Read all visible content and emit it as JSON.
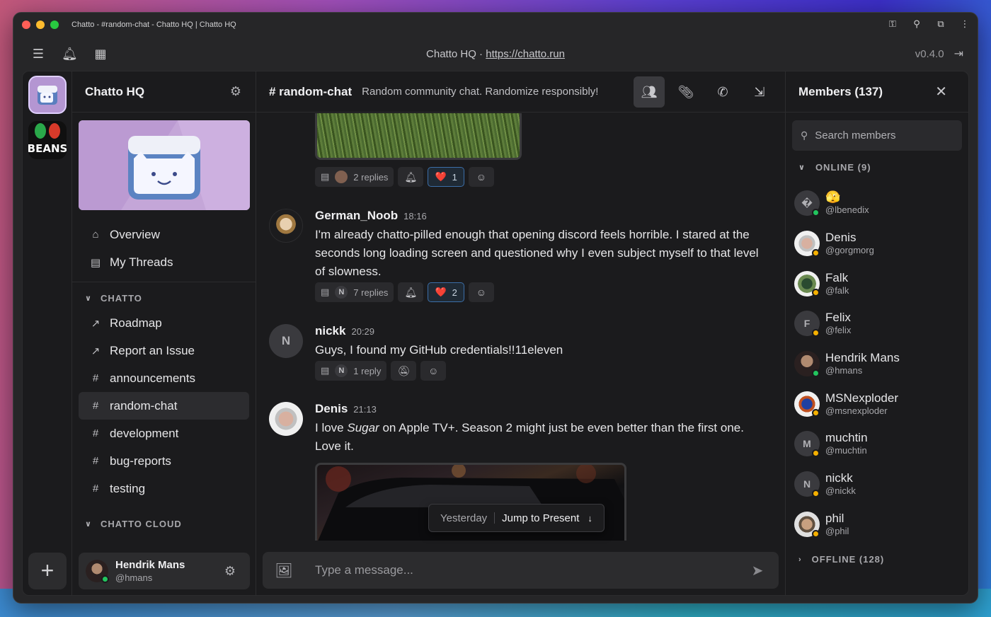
{
  "window": {
    "title": "Chatto - #random-chat - Chatto HQ | Chatto HQ"
  },
  "appbar": {
    "server_label": "Chatto HQ · ",
    "link_text": "https://chatto.run",
    "version": "v0.4.0"
  },
  "sidebar": {
    "server_name": "Chatto HQ",
    "nav": [
      {
        "label": "Overview",
        "icon": "home-icon"
      },
      {
        "label": "My Threads",
        "icon": "threads-icon"
      }
    ],
    "sections": [
      {
        "title": "CHATTO",
        "items": [
          {
            "label": "Roadmap",
            "icon": "external-link-icon"
          },
          {
            "label": "Report an Issue",
            "icon": "external-link-icon"
          },
          {
            "label": "announcements",
            "icon": "hash-icon"
          },
          {
            "label": "random-chat",
            "icon": "hash-icon",
            "active": true
          },
          {
            "label": "development",
            "icon": "hash-icon"
          },
          {
            "label": "bug-reports",
            "icon": "hash-icon"
          },
          {
            "label": "testing",
            "icon": "hash-icon"
          }
        ]
      },
      {
        "title": "CHATTO CLOUD"
      }
    ],
    "user": {
      "name": "Hendrik Mans",
      "handle": "@hmans"
    }
  },
  "channel": {
    "name": "# random-chat",
    "topic": "Random community chat. Randomize responsibly!"
  },
  "messages": [
    {
      "tools": {
        "replies": "2 replies",
        "reaction_emoji": "❤️",
        "reaction_count": "1"
      }
    },
    {
      "author": "German_Noob",
      "time": "18:16",
      "body": "I'm already chatto-pilled enough that opening discord feels horrible. I stared at the seconds long loading screen and questioned why I even subject myself to that level of slowness.",
      "tools": {
        "replies": "7 replies",
        "reaction_emoji": "❤️",
        "reaction_count": "2",
        "avatar_initial": "N"
      }
    },
    {
      "author": "nickk",
      "time": "20:29",
      "avatar_initial": "N",
      "body": "Guys, I found my GitHub credentials!!11eleven",
      "tools": {
        "replies": "1 reply",
        "avatar_initial": "N"
      }
    },
    {
      "author": "Denis",
      "time": "21:13",
      "body_pre": "I love ",
      "body_em": "Sugar",
      "body_post": " on Apple TV+. Season 2 might just be even better than the first one. Love it."
    }
  ],
  "jump": {
    "day": "Yesterday",
    "label": "Jump to Present",
    "arrow": "↓"
  },
  "composer": {
    "placeholder": "Type a message..."
  },
  "members": {
    "title": "Members (137)",
    "search_placeholder": "Search members",
    "online_label": "ONLINE (9)",
    "offline_label": "OFFLINE (128)",
    "list": [
      {
        "name": "🫣",
        "handle": "@lbenedix",
        "status": "online",
        "initial": "�"
      },
      {
        "name": "Denis",
        "handle": "@gorgmorg",
        "status": "away",
        "initial": ""
      },
      {
        "name": "Falk",
        "handle": "@falk",
        "status": "away",
        "initial": ""
      },
      {
        "name": "Felix",
        "handle": "@felix",
        "status": "away",
        "initial": "F"
      },
      {
        "name": "Hendrik Mans",
        "handle": "@hmans",
        "status": "online",
        "initial": ""
      },
      {
        "name": "MSNexploder",
        "handle": "@msnexploder",
        "status": "away",
        "initial": ""
      },
      {
        "name": "muchtin",
        "handle": "@muchtin",
        "status": "away",
        "initial": "M"
      },
      {
        "name": "nickk",
        "handle": "@nickk",
        "status": "away",
        "initial": "N"
      },
      {
        "name": "phil",
        "handle": "@phil",
        "status": "away",
        "initial": ""
      }
    ]
  },
  "colors": {
    "online": "#22c55e",
    "away": "#f5b000",
    "reaction_border": "#3b6ea8",
    "banner": "#c4a6d8"
  }
}
